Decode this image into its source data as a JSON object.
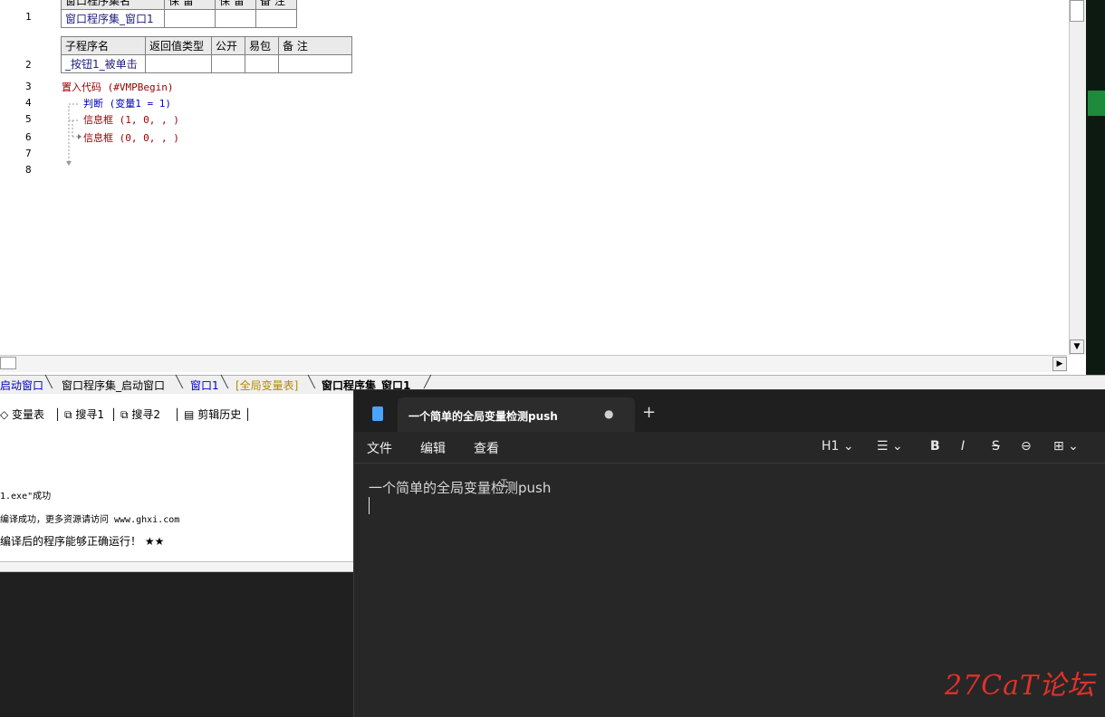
{
  "editor": {
    "table1": {
      "line": "1",
      "header": [
        "窗口程序集名",
        "保 留",
        "保 留",
        "备 注"
      ],
      "row": [
        "窗口程序集_窗口1",
        "",
        "",
        ""
      ]
    },
    "table2": {
      "line": "2",
      "header": [
        "子程序名",
        "返回值类型",
        "公开",
        "易包",
        "备 注"
      ],
      "row": [
        "_按钮1_被单击",
        "",
        "",
        "",
        ""
      ]
    },
    "lines": [
      {
        "num": "3",
        "text": "置入代码 (#VMPBegin)"
      },
      {
        "num": "4",
        "text": "判断 (变量1 = 1)"
      },
      {
        "num": "5",
        "text": "信息框 (1, 0, , )"
      },
      {
        "num": "6",
        "text": "信息框 (0, 0, , )"
      },
      {
        "num": "7",
        "text": ""
      },
      {
        "num": "8",
        "text": ""
      }
    ]
  },
  "tabs": [
    "启动窗口",
    "窗口程序集_启动窗口",
    "窗口1",
    "[全局变量表]",
    "窗口程序集_窗口1"
  ],
  "bottom_toolbar": [
    "变量表",
    "搜寻1",
    "搜寻2",
    "剪辑历史"
  ],
  "output": [
    "1.exe\"成功",
    "编译成功，更多资源请访问 www.ghxi.com",
    "编译后的程序能够正确运行！ ★★"
  ],
  "notepad": {
    "tab_title": "一个简单的全局变量检测push",
    "modified_dot": "●",
    "new_tab": "+",
    "menu": [
      "文件",
      "编辑",
      "查看"
    ],
    "tools": [
      "H1 ⌄",
      "☰ ⌄",
      "B",
      "I",
      "S",
      "⊖",
      "⊞ ⌄"
    ],
    "content": "一个简单的全局变量检测push"
  },
  "watermark": "27CaT论坛"
}
